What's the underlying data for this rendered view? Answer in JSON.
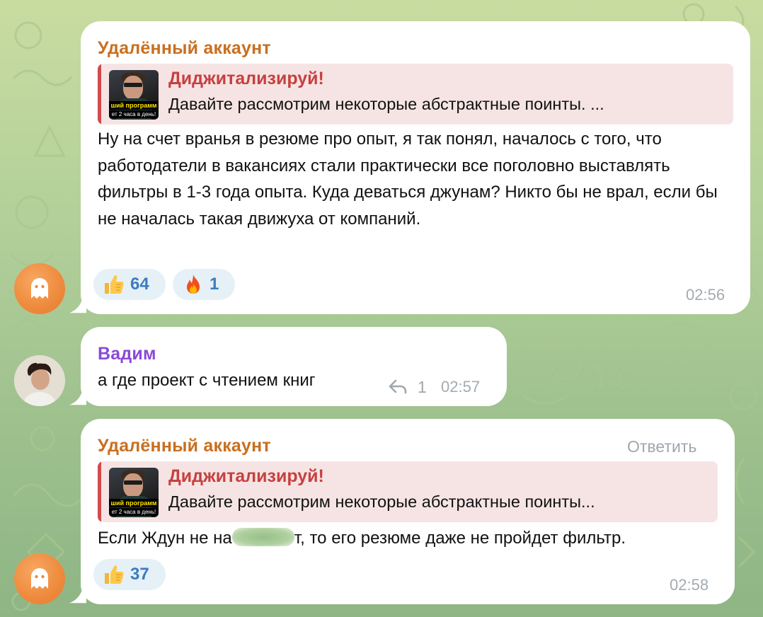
{
  "colors": {
    "bubble_bg": "#ffffff",
    "sender_deleted": "#c96f1f",
    "sender_vadim": "#8a49d6",
    "reply_accent": "#d24a4a",
    "reply_bg": "#f6e4e4",
    "reaction_bg": "#e6f0f7",
    "reaction_count": "#3b7cc0",
    "time": "#a2abb3"
  },
  "messages": [
    {
      "sender": "Удалённый аккаунт",
      "avatar_icon": "ghost-icon",
      "reply": {
        "title": "Диджитализируй!",
        "text": "Давайте рассмотрим некоторые абстрактные поинты.  ...",
        "thumb_caption_1": "ший программ",
        "thumb_caption_2": "ет 2 часа в день!"
      },
      "text": "Ну на счет вранья в резюме про опыт, я так понял, началось с того, что работодатели в вакансиях стали практически все поголовно выставлять фильтры в 1-3 года опыта. Куда деваться джунам? Никто бы не врал, если бы не началась такая движуха от компаний.",
      "reactions": [
        {
          "emoji": "thumbs-up-icon",
          "count": "64"
        },
        {
          "emoji": "fire-icon",
          "count": "1"
        }
      ],
      "time": "02:56"
    },
    {
      "sender": "Вадим",
      "avatar_icon": "user-photo",
      "text": "а где проект с чтением книг",
      "replies_icon": "reply-arrow-icon",
      "replies_count": "1",
      "time": "02:57"
    },
    {
      "sender": "Удалённый аккаунт",
      "avatar_icon": "ghost-icon",
      "reply_action": "Ответить",
      "reply": {
        "title": "Диджитализируй!",
        "text": "Давайте рассмотрим некоторые абстрактные поинты...",
        "thumb_caption_1": "ший программ",
        "thumb_caption_2": "ет 2 часа в день!"
      },
      "text_before": "Если Ждун не на",
      "text_after": "т, то его резюме даже не пройдет фильтр.",
      "reactions": [
        {
          "emoji": "thumbs-up-icon",
          "count": "37"
        }
      ],
      "time": "02:58"
    }
  ]
}
